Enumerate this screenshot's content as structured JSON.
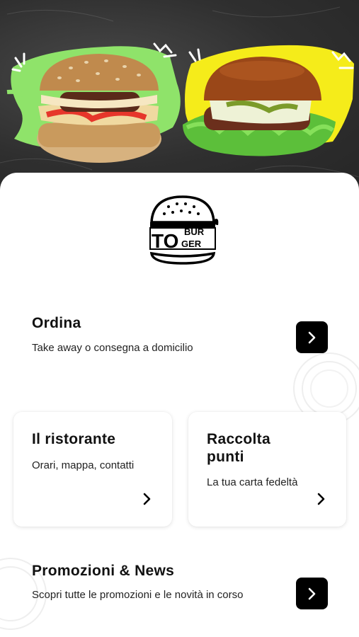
{
  "brand": {
    "logo_text_top": "BUR",
    "logo_text_left": "TO",
    "logo_text_bottom": "GER"
  },
  "colors": {
    "accent_green": "#8fe36a",
    "accent_yellow": "#f5ec1a",
    "button": "#000000",
    "hero_background": "#2f2f2f"
  },
  "order": {
    "title": "Ordina",
    "subtitle": "Take away o consegna a domicilio",
    "icon": "chevron-right-icon"
  },
  "cards": [
    {
      "title": "Il ristorante",
      "subtitle": "Orari, mappa, contatti",
      "icon": "chevron-right-icon"
    },
    {
      "title": "Raccolta punti",
      "subtitle": "La tua carta fedeltà",
      "icon": "chevron-right-icon"
    }
  ],
  "promo": {
    "title": "Promozioni & News",
    "subtitle": "Scopri tutte le promozioni e le novità in corso",
    "icon": "chevron-right-icon"
  }
}
